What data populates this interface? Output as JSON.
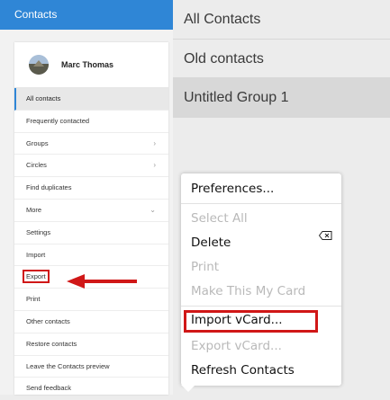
{
  "sidebar": {
    "title": "Contacts",
    "user_name": "Marc Thomas",
    "items": [
      {
        "label": "All contacts",
        "chevron": ""
      },
      {
        "label": "Frequently contacted",
        "chevron": ""
      },
      {
        "label": "Groups",
        "chevron": "›"
      },
      {
        "label": "Circles",
        "chevron": "›"
      },
      {
        "label": "Find duplicates",
        "chevron": ""
      },
      {
        "label": "More",
        "chevron": "⌄"
      },
      {
        "label": "Settings",
        "chevron": ""
      },
      {
        "label": "Import",
        "chevron": ""
      },
      {
        "label": "Export",
        "chevron": ""
      },
      {
        "label": "Print",
        "chevron": ""
      },
      {
        "label": "Other contacts",
        "chevron": ""
      },
      {
        "label": "Restore contacts",
        "chevron": ""
      },
      {
        "label": "Leave the Contacts preview",
        "chevron": ""
      },
      {
        "label": "Send feedback",
        "chevron": ""
      }
    ]
  },
  "groups": [
    {
      "label": "All Contacts"
    },
    {
      "label": "Old contacts"
    },
    {
      "label": "Untitled Group 1"
    }
  ],
  "context_menu": {
    "items": [
      {
        "label": "Preferences..."
      },
      {
        "label": "Select All"
      },
      {
        "label": "Delete"
      },
      {
        "label": "Print"
      },
      {
        "label": "Make This My Card"
      },
      {
        "label": "Import vCard..."
      },
      {
        "label": "Export vCard..."
      },
      {
        "label": "Refresh Contacts"
      }
    ]
  },
  "colors": {
    "header_blue": "#2f86d6",
    "highlight_red": "#d01717"
  }
}
